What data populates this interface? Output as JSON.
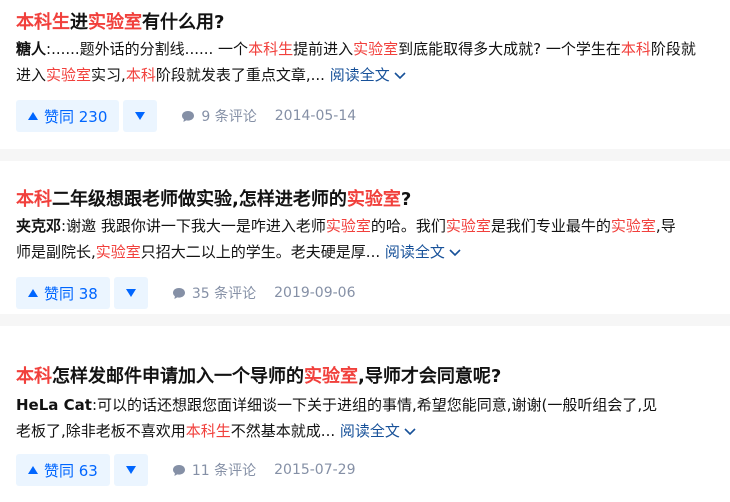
{
  "results": [
    {
      "title_parts": [
        [
          "本科生",
          true
        ],
        [
          "进",
          false
        ],
        [
          "实验室",
          true
        ],
        [
          "有什么用?",
          false
        ]
      ],
      "author": "糖人",
      "excerpt_lines": [
        [
          [
            ":......题外话的分割线...... 一个",
            false
          ],
          [
            "本科生",
            true
          ],
          [
            "提前进入",
            false
          ],
          [
            "实验室",
            true
          ],
          [
            "到底能取得多大成就? 一个学生在",
            false
          ],
          [
            "本科",
            true
          ],
          [
            "阶段就",
            false
          ]
        ],
        [
          [
            "进入",
            false
          ],
          [
            "实验室",
            true
          ],
          [
            "实习,",
            false
          ],
          [
            "本科",
            true
          ],
          [
            "阶段就发表了重点文章,...",
            false
          ]
        ]
      ],
      "read_more": "阅读全文",
      "upvote_label": "赞同 230",
      "comments_label": "9 条评论",
      "date": "2014-05-14"
    },
    {
      "title_parts": [
        [
          "本科",
          true
        ],
        [
          "二年级想跟老师做实验,怎样进老师的",
          false
        ],
        [
          "实验室",
          true
        ],
        [
          "?",
          false
        ]
      ],
      "author": "夹克邓",
      "excerpt_lines": [
        [
          [
            ":谢邀 我跟你讲一下我大一是咋进入老师",
            false
          ],
          [
            "实验室",
            true
          ],
          [
            "的哈。我们",
            false
          ],
          [
            "实验室",
            true
          ],
          [
            "是我们专业最牛的",
            false
          ],
          [
            "实验室",
            true
          ],
          [
            ",导",
            false
          ]
        ],
        [
          [
            "师是副院长,",
            false
          ],
          [
            "实验室",
            true
          ],
          [
            "只招大二以上的学生。老夫硬是厚...",
            false
          ]
        ]
      ],
      "read_more": "阅读全文",
      "upvote_label": "赞同 38",
      "comments_label": "35 条评论",
      "date": "2019-09-06"
    },
    {
      "title_parts": [
        [
          "本科",
          true
        ],
        [
          "怎样发邮件申请加入一个导师的",
          false
        ],
        [
          "实验室",
          true
        ],
        [
          ",导师才会同意呢?",
          false
        ]
      ],
      "author": "HeLa Cat",
      "excerpt_lines": [
        [
          [
            ":可以的话还想跟您面详细谈一下关于进组的事情,希望您能同意,谢谢(一般听组会了,见",
            false
          ]
        ],
        [
          [
            "老板了,除非老板不喜欢用",
            false
          ],
          [
            "本科生",
            true
          ],
          [
            "不然基本就成...",
            false
          ]
        ]
      ],
      "read_more": "阅读全文",
      "upvote_label": "赞同 63",
      "comments_label": "11 条评论",
      "date": "2015-07-29"
    }
  ],
  "icons": {
    "upvote": "triangle-up-icon",
    "downvote": "triangle-down-icon",
    "comment": "comment-bubble-icon",
    "read_more_chevron": "chevron-down-icon"
  },
  "colors": {
    "highlight": "#f1403c",
    "link": "#175199",
    "vote": "#0066ff",
    "vote_bg": "#ebf5ff",
    "meta": "#8590a6",
    "divider": "#f6f6f6"
  }
}
